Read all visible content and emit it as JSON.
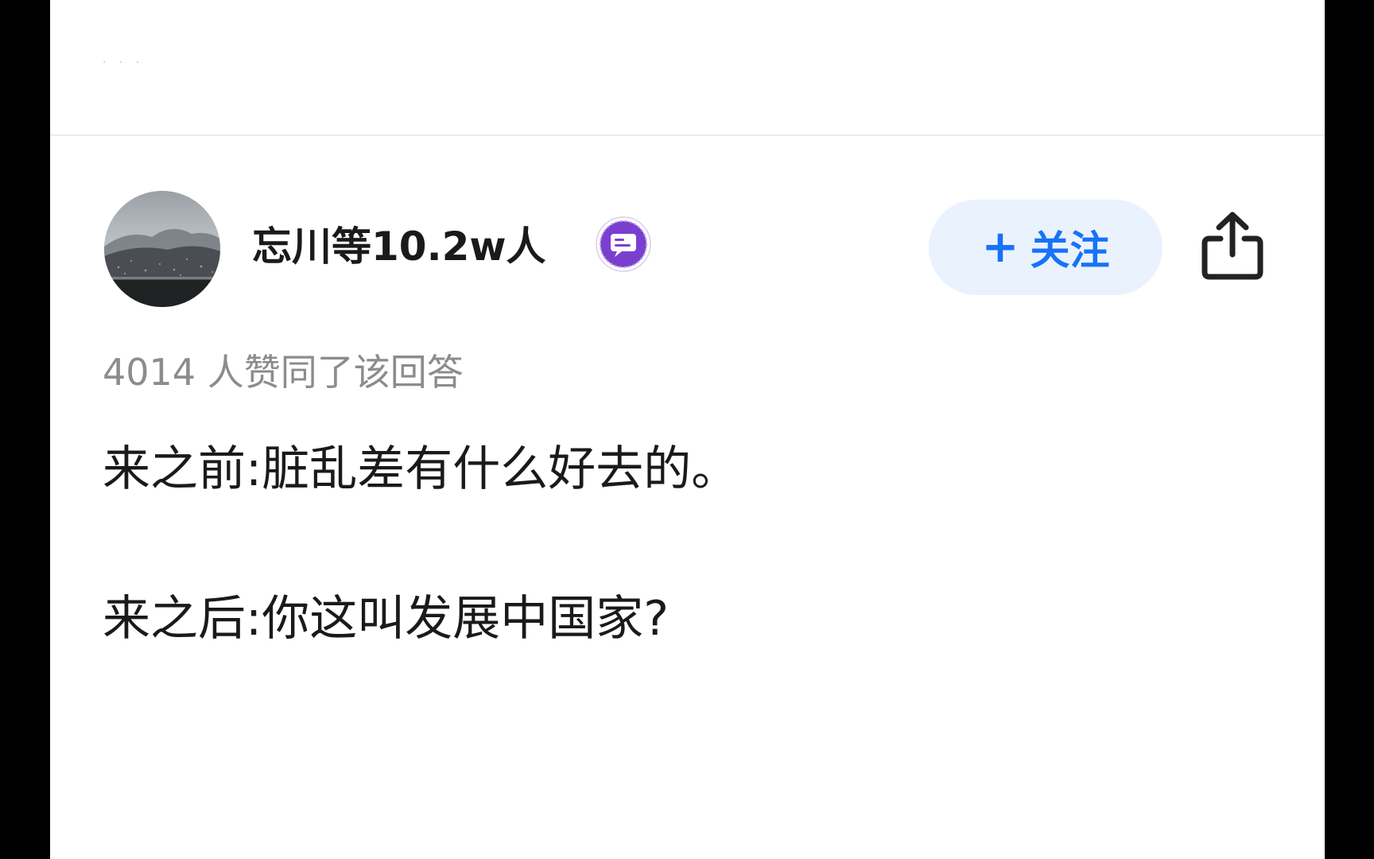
{
  "top_bar": {
    "more_dots": "· · ·"
  },
  "author": {
    "name": "忘川等10.2w人",
    "avatar_icon": "landscape-avatar",
    "badge_icon": "chat-bubble-badge-icon",
    "badge_color": "#7b3fd0"
  },
  "actions": {
    "follow_plus": "+",
    "follow_label": "关注",
    "share_icon": "share-icon",
    "accent_color": "#1772f6"
  },
  "answer": {
    "vote_text": "4014 人赞同了该回答",
    "paragraphs": [
      "来之前:脏乱差有什么好去的。",
      "来之后:你这叫发展中国家?"
    ]
  }
}
